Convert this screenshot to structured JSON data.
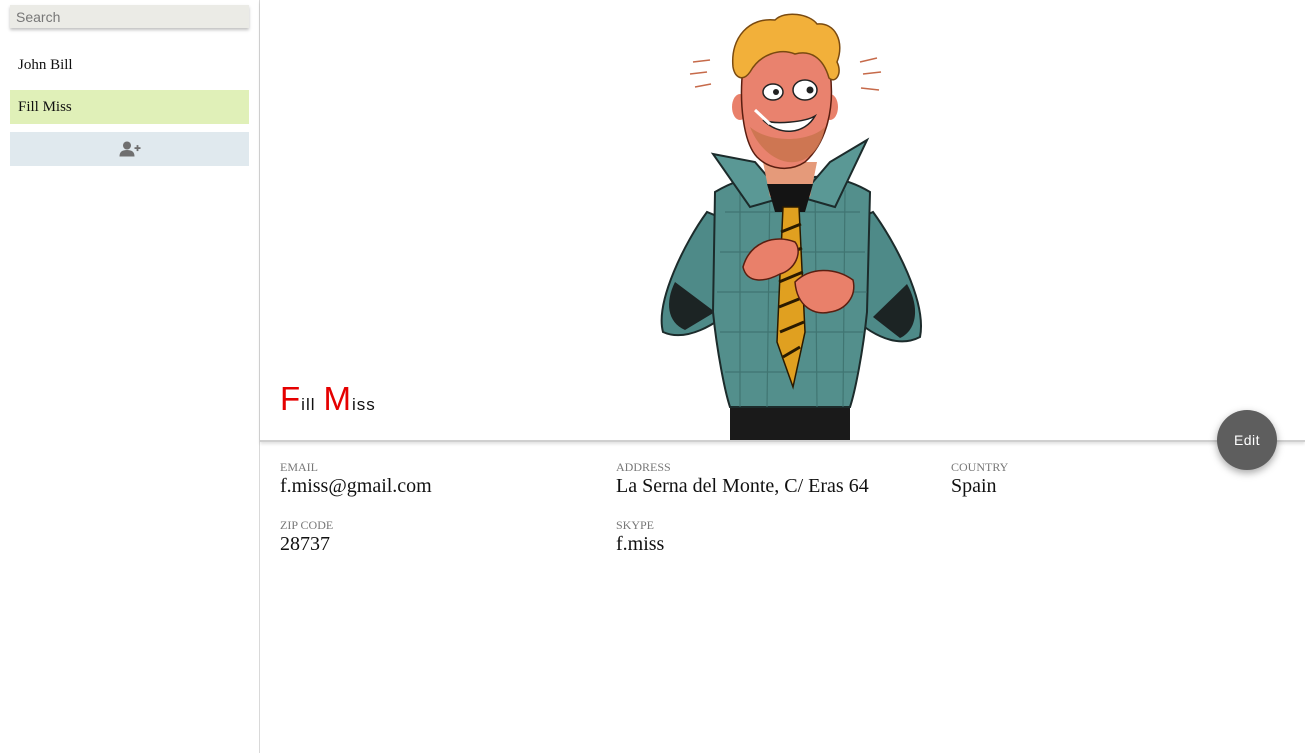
{
  "sidebar": {
    "search_placeholder": "Search",
    "contacts": [
      {
        "label": "John Bill",
        "selected": false
      },
      {
        "label": "Fill Miss",
        "selected": true
      }
    ],
    "add_contact_icon": "add-user-icon",
    "selected_color": "#e0f0b8"
  },
  "profile": {
    "name_parts": [
      {
        "cap": "F",
        "rest": "ill"
      },
      {
        "cap": "M",
        "rest": "iss"
      }
    ],
    "name_accent_color": "#e50000",
    "edit_label": "Edit",
    "fields": {
      "email": {
        "label": "EMAIL",
        "value": "f.miss@gmail.com"
      },
      "address": {
        "label": "ADDRESS",
        "value": "La Serna del Monte, C/ Eras 64"
      },
      "country": {
        "label": "COUNTRY",
        "value": "Spain"
      },
      "zip": {
        "label": "ZIP CODE",
        "value": "28737"
      },
      "skype": {
        "label": "SKYPE",
        "value": "f.miss"
      }
    }
  }
}
